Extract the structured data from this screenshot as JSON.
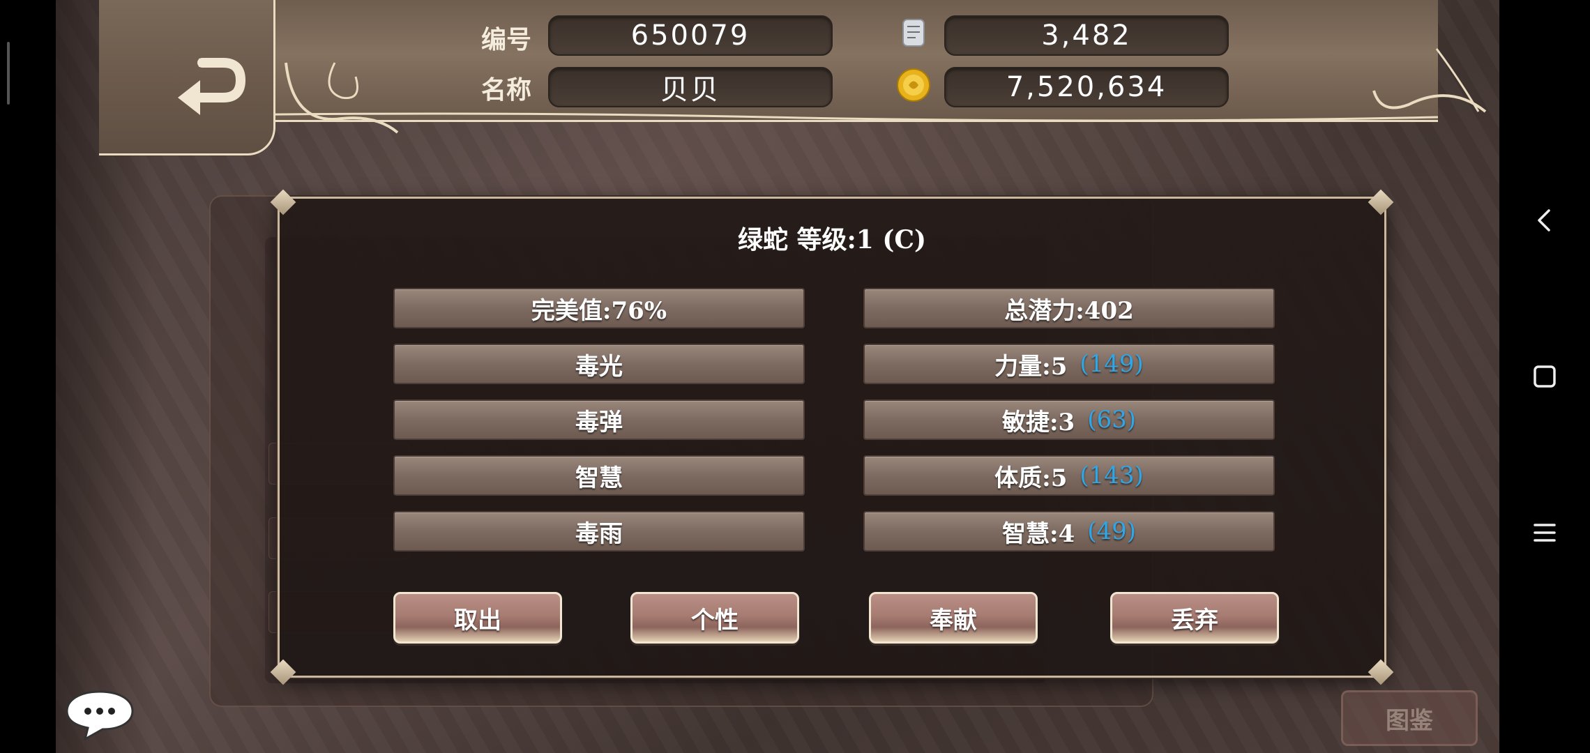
{
  "header": {
    "id_label": "编号",
    "id_value": "650079",
    "name_label": "名称",
    "name_value": "贝贝",
    "gem_value": "3,482",
    "gold_value": "7,520,634"
  },
  "dialog": {
    "title": "绿蛇 等级:1 (C)",
    "left_stats": [
      {
        "label": "完美值:76%"
      },
      {
        "label": "毒光"
      },
      {
        "label": "毒弹"
      },
      {
        "label": "智慧"
      },
      {
        "label": "毒雨"
      }
    ],
    "right_stats": [
      {
        "label": "总潜力:402",
        "bonus": ""
      },
      {
        "label": "力量:5",
        "bonus": "(149)"
      },
      {
        "label": "敏捷:3",
        "bonus": "(63)"
      },
      {
        "label": "体质:5",
        "bonus": "(143)"
      },
      {
        "label": "智慧:4",
        "bonus": "(49)"
      }
    ],
    "buttons": {
      "take_out": "取出",
      "personality": "个性",
      "donate": "奉献",
      "discard": "丢弃"
    }
  },
  "atlas_button": "图鉴",
  "colors": {
    "bonus": "#2fa6e6",
    "header": "#857260",
    "dialog_bg": "#231a18",
    "button": "#a77c72"
  },
  "icons": {
    "back": "return-arrow-icon",
    "gem": "gem-scroll-icon",
    "gold": "gold-coin-icon",
    "chat": "chat-bubble-icon",
    "nav_back": "nav-back-icon",
    "nav_home": "nav-home-icon",
    "nav_menu": "nav-menu-icon"
  }
}
